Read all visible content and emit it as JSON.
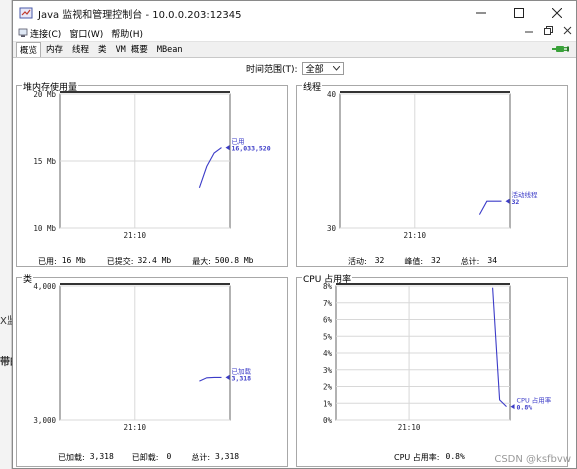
{
  "background": {
    "text1": "X监",
    "text2": "带的"
  },
  "window": {
    "title": "Java 监视和管理控制台 - 10.0.0.203:12345"
  },
  "menu": {
    "items": [
      {
        "label": "连接(C)",
        "icon": "connection-icon"
      },
      {
        "label": "窗口(W)"
      },
      {
        "label": "帮助(H)"
      }
    ]
  },
  "tabs": [
    "概览",
    "内存",
    "线程",
    "类",
    "VM 概要",
    "MBean"
  ],
  "active_tab": "概览",
  "time_range": {
    "label": "时间范围(T):",
    "value": "全部"
  },
  "panels": {
    "heap": {
      "title": "堆内存使用量",
      "stats": {
        "used_label": "已用:",
        "used": "16  Mb",
        "committed_label": "已提交:",
        "committed": "32.4  Mb",
        "max_label": "最大:",
        "max": "500.8  Mb"
      }
    },
    "threads": {
      "title": "线程",
      "stats": {
        "live_label": "活动:",
        "live": "32",
        "peak_label": "峰值:",
        "peak": "32",
        "total_label": "总计:",
        "total": "34"
      }
    },
    "classes": {
      "title": "类",
      "stats": {
        "loaded_label": "已加载:",
        "loaded": "3,318",
        "unloaded_label": "已卸载:",
        "unloaded": "0",
        "total_label": "总计:",
        "total": "3,318"
      }
    },
    "cpu": {
      "title": "CPU 占用率",
      "stats": {
        "usage_label": "CPU 占用率:",
        "usage": "0.8%"
      }
    }
  },
  "chart_data": [
    {
      "type": "line",
      "title": "堆内存使用量",
      "y_ticks": [
        "20 Mb",
        "15 Mb",
        "10 Mb"
      ],
      "ylim": [
        10,
        20
      ],
      "x_ticks": [
        "21:10"
      ],
      "series": [
        {
          "name": "已用",
          "color": "#3c3cc8",
          "points": [
            13.0,
            14.6,
            15.6,
            16.0
          ],
          "last_label": "16,033,520"
        }
      ]
    },
    {
      "type": "line",
      "title": "线程",
      "y_ticks": [
        "40",
        "30"
      ],
      "ylim": [
        30,
        40
      ],
      "x_ticks": [
        "21:10"
      ],
      "series": [
        {
          "name": "活动线程",
          "color": "#3c3cc8",
          "points": [
            31.0,
            32.0,
            32.0,
            32.0
          ],
          "last_label": "32"
        }
      ]
    },
    {
      "type": "line",
      "title": "类",
      "y_ticks": [
        "4,000",
        "3,000"
      ],
      "ylim": [
        3000,
        4000
      ],
      "x_ticks": [
        "21:10"
      ],
      "series": [
        {
          "name": "已加载",
          "color": "#3c3cc8",
          "points": [
            3290,
            3315,
            3318,
            3318
          ],
          "last_label": "3,318"
        }
      ]
    },
    {
      "type": "line",
      "title": "CPU 占用率",
      "y_ticks": [
        "8%",
        "7%",
        "6%",
        "5%",
        "4%",
        "3%",
        "2%",
        "1%",
        "0%"
      ],
      "ylim": [
        0,
        8
      ],
      "x_ticks": [
        "21:10"
      ],
      "series": [
        {
          "name": "CPU 占用率",
          "color": "#3c3cc8",
          "points": [
            7.9,
            1.2,
            0.8
          ],
          "last_label": "0.8%"
        }
      ]
    }
  ],
  "watermark": "CSDN @ksfbvw"
}
